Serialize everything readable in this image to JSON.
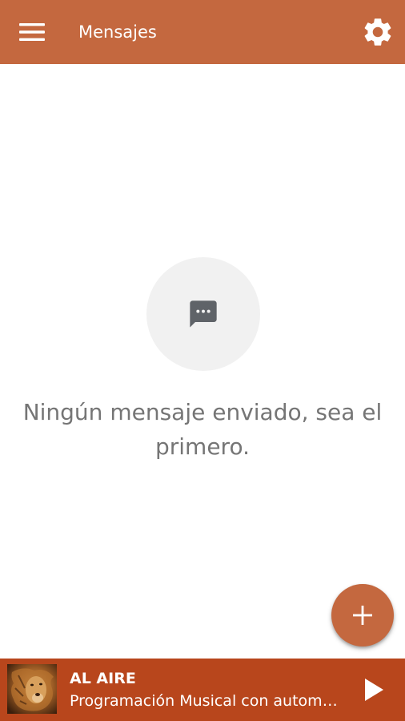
{
  "app_bar": {
    "title": "Mensajes",
    "menu_icon": "hamburger-menu-icon",
    "settings_icon": "gear-icon",
    "color": "#c4683f"
  },
  "empty_state": {
    "icon": "chat-bubble-icon",
    "message": "Ningún mensaje enviado, sea el primero."
  },
  "fab": {
    "icon": "plus-icon",
    "color": "#c4683f"
  },
  "player": {
    "status": "AL AIRE",
    "now_playing": "Programación Musical con automatización",
    "cover_icon": "lion-cover-art",
    "play_icon": "play-icon",
    "color": "#b8461c"
  }
}
